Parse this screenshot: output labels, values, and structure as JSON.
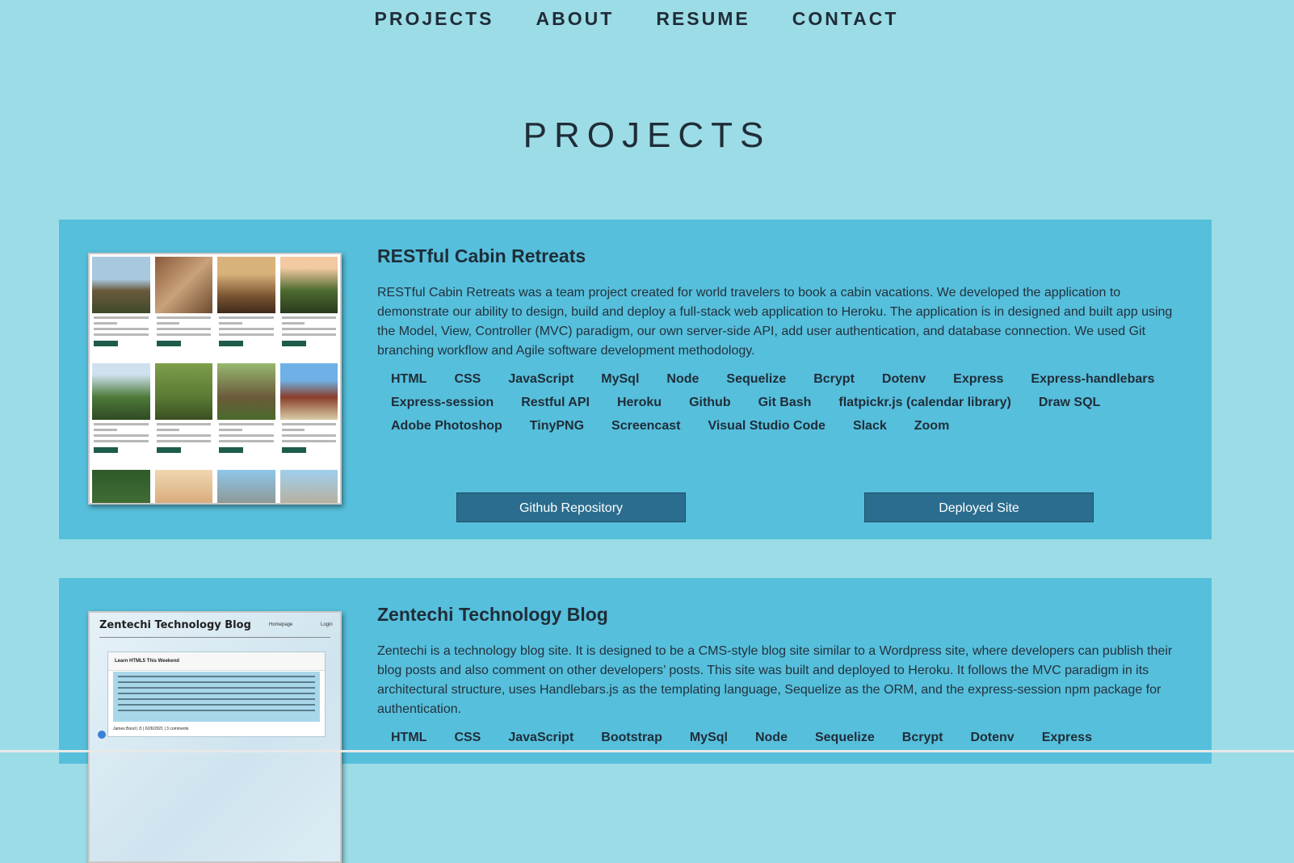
{
  "nav": {
    "items": [
      "PROJECTS",
      "ABOUT",
      "RESUME",
      "CONTACT"
    ]
  },
  "page": {
    "heading": "PROJECTS"
  },
  "projects": [
    {
      "title": "RESTful Cabin Retreats",
      "description": "RESTful Cabin Retreats was a team project created for world travelers to book a cabin vacations. We developed the application to demonstrate our ability to design, build and deploy a full-stack web application to Heroku. The application is in designed and built app using the Model, View, Controller (MVC) paradigm, our own server-side API, add user authentication, and database connection. We used Git branching workflow and Agile software development methodology.",
      "tags": [
        "HTML",
        "CSS",
        "JavaScript",
        "MySql",
        "Node",
        "Sequelize",
        "Bcrypt",
        "Dotenv",
        "Express",
        "Express-handlebars",
        "Express-session",
        "Restful API",
        "Heroku",
        "Github",
        "Git Bash",
        "flatpickr.js (calendar library)",
        "Draw SQL",
        "Adobe Photoshop",
        "TinyPNG",
        "Screencast",
        "Visual Studio Code",
        "Slack",
        "Zoom"
      ],
      "github_label": "Github Repository",
      "deployed_label": "Deployed Site"
    },
    {
      "title": "Zentechi Technology Blog",
      "description": "Zentechi is a technology blog site. It is designed to be a CMS-style blog site similar to a Wordpress site, where developers can publish their blog posts and also comment on other developers’ posts. This site was built and deployed to Heroku. It follows the MVC paradigm in its architectural structure, uses Handlebars.js as the templating language, Sequelize as the ORM, and the express-session npm package for authentication.",
      "tags": [
        "HTML",
        "CSS",
        "JavaScript",
        "Bootstrap",
        "MySql",
        "Node",
        "Sequelize",
        "Bcrypt",
        "Dotenv",
        "Express"
      ],
      "thumb": {
        "site_title": "Zentechi Technology Blog",
        "nav_home": "Homepage",
        "nav_login": "Login",
        "post_title": "Learn HTML5 This Weekend",
        "post_footer": "James Bond | ⏱ | 6/26/2021 | 3 comments"
      }
    }
  ],
  "colors": {
    "background": "#9cdce6",
    "card": "#56bfdc",
    "button": "#2a6d8e",
    "text": "#1f2d38"
  }
}
